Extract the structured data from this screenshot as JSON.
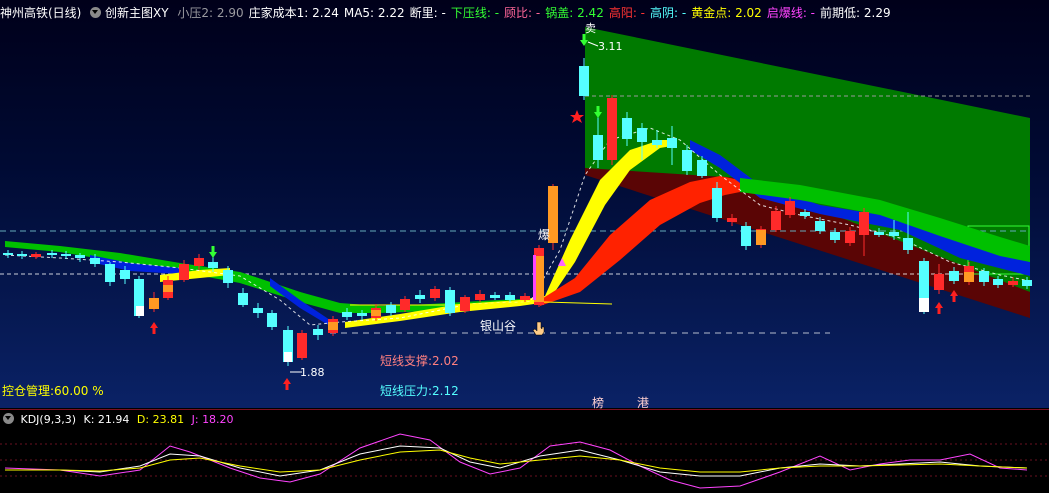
{
  "header": {
    "stock_name": "神州高铁(日线)",
    "indicator_name": "创新主图XY",
    "fields": [
      {
        "label": "小压2:",
        "value": "2.90",
        "color": "#9a9aa0"
      },
      {
        "label": "庄家成本1:",
        "value": "2.24",
        "color": "#ffffff"
      },
      {
        "label": "MA5:",
        "value": "2.22",
        "color": "#ffffff"
      },
      {
        "label": "断里:",
        "value": "-",
        "color": "#ffffff"
      },
      {
        "label": "下压线:",
        "value": "-",
        "color": "#33ff33"
      },
      {
        "label": "顾比:",
        "value": "-",
        "color": "#ff6699"
      },
      {
        "label": "锅盖:",
        "value": "2.42",
        "color": "#33ff33"
      },
      {
        "label": "高阳:",
        "value": "-",
        "color": "#ff3333"
      },
      {
        "label": "高阴:",
        "value": "-",
        "color": "#55ffff"
      },
      {
        "label": "黄金点:",
        "value": "2.02",
        "color": "#ffff00"
      },
      {
        "label": "启爆线:",
        "value": "-",
        "color": "#ff44ff"
      },
      {
        "label": "前期低:",
        "value": "2.29",
        "color": "#ffffff"
      }
    ]
  },
  "annotations": {
    "high_price": "3.11",
    "low_price": "1.88",
    "explode_label": "爆",
    "valley_label": "银山谷",
    "short_support_label": "短线支撑:",
    "short_support_value": "2.02",
    "short_pressure_label": "短线压力:",
    "short_pressure_value": "2.12",
    "position_label": "控仓管理:",
    "position_value": "60.00 %",
    "sell_label": "卖",
    "tag_1": "榜",
    "tag_2": "港"
  },
  "kdj": {
    "title": "KDJ(9,3,3)",
    "k_label": "K:",
    "k_value": "21.94",
    "d_label": "D:",
    "d_value": "23.81",
    "j_label": "J:",
    "j_value": "18.20",
    "k_color": "#ffffff",
    "d_color": "#ffff00",
    "j_color": "#ff44ff"
  },
  "colors": {
    "up": "#ff2a2a",
    "down": "#55ffff",
    "ribbon_green": "#00c000",
    "ribbon_blue": "#0022dd",
    "ribbon_yellow": "#ffff00",
    "ribbon_red": "#ff2200",
    "channel_green": "#007a00",
    "channel_red": "#5a0505"
  }
}
